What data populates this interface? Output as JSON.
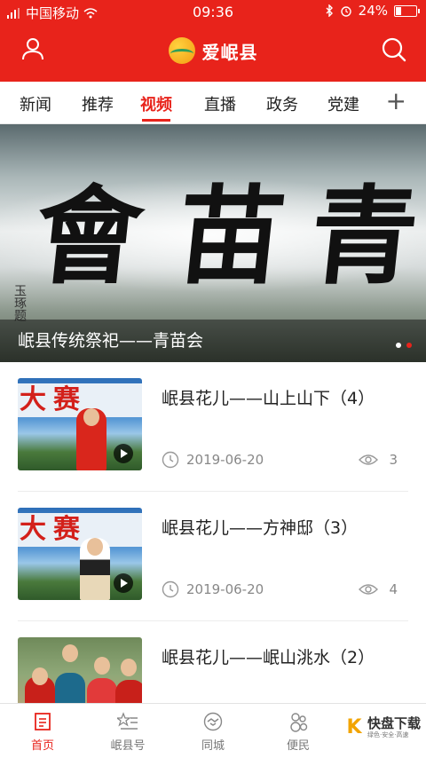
{
  "status_bar": {
    "carrier": "中国移动",
    "time": "09:36",
    "battery": "24%"
  },
  "header": {
    "app_name": "爱岷县"
  },
  "tabs": [
    {
      "label": "新闻"
    },
    {
      "label": "推荐"
    },
    {
      "label": "视频"
    },
    {
      "label": "直播"
    },
    {
      "label": "政务"
    },
    {
      "label": "党建"
    }
  ],
  "banner": {
    "caption": "岷县传统祭祀——青苗会",
    "calligraphy": [
      "會",
      "苗",
      "青"
    ],
    "signature": "玉琢题"
  },
  "videos": [
    {
      "title": "岷县花儿——山上山下（4）",
      "date": "2019-06-20",
      "views": "3",
      "sign_text": "大赛"
    },
    {
      "title": "岷县花儿——方神邸（3）",
      "date": "2019-06-20",
      "views": "4",
      "sign_text": "大赛"
    },
    {
      "title": "岷县花儿——岷山洮水（2）",
      "date": "",
      "views": "",
      "sign_text": ""
    }
  ],
  "bottom_nav": [
    {
      "label": "首页",
      "icon": "home-icon"
    },
    {
      "label": "岷县号",
      "icon": "star-list-icon"
    },
    {
      "label": "同城",
      "icon": "handshake-icon"
    },
    {
      "label": "便民",
      "icon": "people-icon"
    }
  ],
  "watermark": {
    "logo": "K",
    "name": "快盘下载",
    "slogan": "绿色·安全·高速"
  },
  "colors": {
    "brand": "#e8231b",
    "text": "#222222",
    "muted": "#888888"
  }
}
